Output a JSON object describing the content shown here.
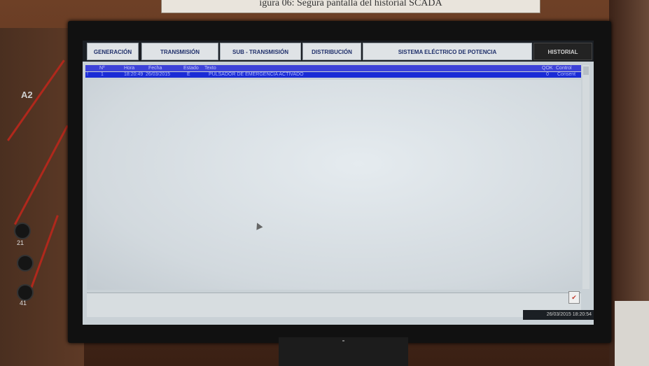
{
  "header_paper": {
    "text": "igura 06: Segura pantalla del historial SCADA"
  },
  "panel": {
    "label": "A2",
    "jack_labels": [
      "21",
      "41"
    ]
  },
  "tabs": [
    {
      "label": "GENERACIÓN",
      "active": false
    },
    {
      "label": "TRANSMISIÓN",
      "active": false
    },
    {
      "label": "SUB - TRANSMISIÓN",
      "active": false
    },
    {
      "label": "DISTRIBUCIÓN",
      "active": false
    },
    {
      "label": "SISTEMA ELÉCTRICO DE POTENCIA",
      "active": false
    },
    {
      "label": "HISTORIAL",
      "active": true
    }
  ],
  "table": {
    "headers": {
      "n": "Nº",
      "hora": "Hora",
      "fecha": "Fecha",
      "estado": "Estado",
      "texto": "Texto",
      "qok": "QOK",
      "control": "Control"
    },
    "rows": [
      {
        "flag": "!",
        "n": "1",
        "hora": "18:20:49",
        "fecha": "26/03/2015",
        "estado": "E",
        "texto": "PULSADOR DE EMERGENCIA ACTIVADO",
        "qok": "0",
        "control": "Consent"
      }
    ]
  },
  "status_bar": {
    "datetime": "26/03/2015 18:20:54",
    "icon": "alarm-check-icon"
  },
  "colors": {
    "header_blue": "#3d42d8",
    "row_blue": "#1a2bd6",
    "tab_bg": "#dfe3e6",
    "active_tab": "#232323"
  }
}
